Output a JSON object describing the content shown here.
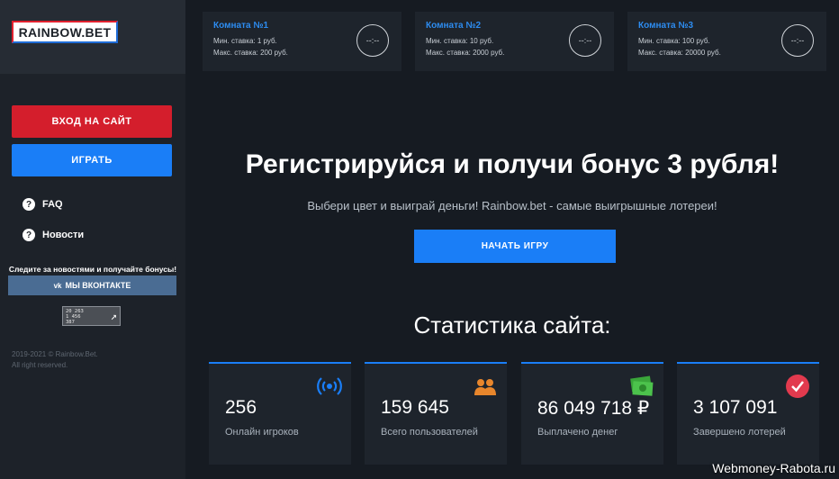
{
  "sidebar": {
    "logo": "RAINBOW.BET",
    "login_button": "ВХОД НА САЙТ",
    "play_button": "ИГРАТЬ",
    "nav": [
      {
        "label": "FAQ"
      },
      {
        "label": "Новости"
      }
    ],
    "follow_text": "Следите за новостями и получайте бонусы!",
    "vk_button": "МЫ ВКОНТАКТЕ",
    "counter": {
      "line1": "20 263",
      "line2": "1 456",
      "line3": "387"
    },
    "copyright_line1": "2019-2021 © Rainbow.Bet.",
    "copyright_line2": "All right reserved."
  },
  "rooms": [
    {
      "title": "Комната №1",
      "min_bet": "Мин. ставка: 1 руб.",
      "max_bet": "Макс. ставка: 200 руб.",
      "timer": "--:--"
    },
    {
      "title": "Комната №2",
      "min_bet": "Мин. ставка: 10 руб.",
      "max_bet": "Макс. ставка: 2000 руб.",
      "timer": "--:--"
    },
    {
      "title": "Комната №3",
      "min_bet": "Мин. ставка: 100 руб.",
      "max_bet": "Макс. ставка: 20000 руб.",
      "timer": "--:--"
    }
  ],
  "hero": {
    "title": "Регистрируйся и получи бонус 3 рубля!",
    "subtitle": "Выбери цвет и выиграй деньги! Rainbow.bet - самые выигрышные лотереи!",
    "start_button": "НАЧАТЬ ИГРУ"
  },
  "stats": {
    "title": "Статистика сайта:",
    "cards": [
      {
        "value": "256",
        "label": "Онлайн игроков",
        "icon": "broadcast-icon"
      },
      {
        "value": "159 645",
        "label": "Всего пользователей",
        "icon": "users-icon"
      },
      {
        "value": "86 049 718 ₽",
        "label": "Выплачено денег",
        "icon": "money-icon"
      },
      {
        "value": "3 107 091",
        "label": "Завершено лотерей",
        "icon": "checkmark-icon"
      }
    ]
  },
  "watermark": "Webmoney-Rabota.ru",
  "colors": {
    "accent_blue": "#1a7ef7",
    "accent_red": "#d41e2c",
    "background": "#161b22",
    "sidebar": "#1d2229",
    "card": "#1e242c"
  }
}
